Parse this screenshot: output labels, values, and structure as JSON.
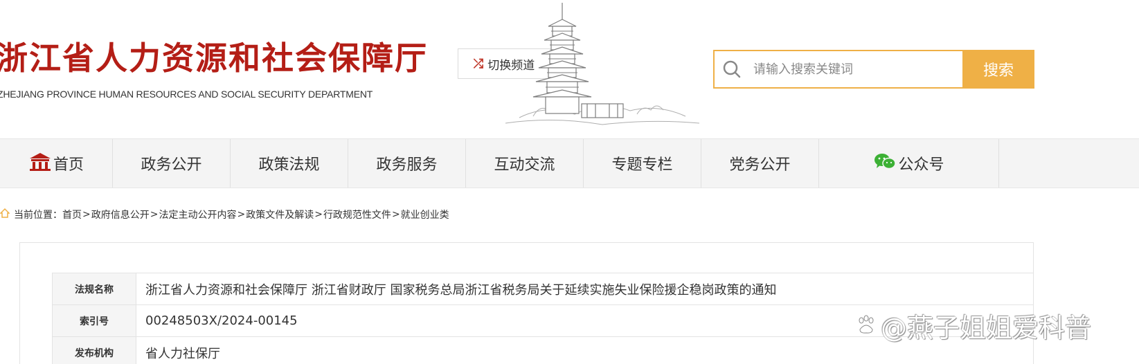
{
  "header": {
    "title": "浙江省人力资源和社会保障厅",
    "subtitle": "ZHEJIANG PROVINCE HUMAN RESOURCES AND SOCIAL SECURITY DEPARTMENT",
    "switch_channel_label": "切换频道",
    "search": {
      "placeholder": "请输入搜索关键词",
      "value": "",
      "button_label": "搜索"
    },
    "brand_color": "#b41e16",
    "accent_color": "#efb046"
  },
  "nav": {
    "items": [
      {
        "label": "首页",
        "icon": "home-icon"
      },
      {
        "label": "政务公开"
      },
      {
        "label": "政策法规"
      },
      {
        "label": "政务服务"
      },
      {
        "label": "互动交流"
      },
      {
        "label": "专题专栏"
      },
      {
        "label": "党务公开"
      },
      {
        "label": "公众号",
        "icon": "wechat-icon"
      }
    ]
  },
  "breadcrumb": {
    "prefix": "当前位置：",
    "items": [
      "首页",
      "政府信息公开",
      "法定主动公开内容",
      "政策文件及解读",
      "行政规范性文件",
      "就业创业类"
    ],
    "separator": ">"
  },
  "document": {
    "rows": [
      {
        "key": "法规名称",
        "value": "浙江省人力资源和社会保障厅 浙江省财政厅 国家税务总局浙江省税务局关于延续实施失业保险援企稳岗政策的通知"
      },
      {
        "key": "索引号",
        "value": "00248503X/2024-00145"
      },
      {
        "key": "发布机构",
        "value": "省人力社保厅"
      }
    ]
  },
  "watermark": {
    "text": "@燕子姐姐爱科普",
    "icon": "baidu-paw-icon"
  }
}
